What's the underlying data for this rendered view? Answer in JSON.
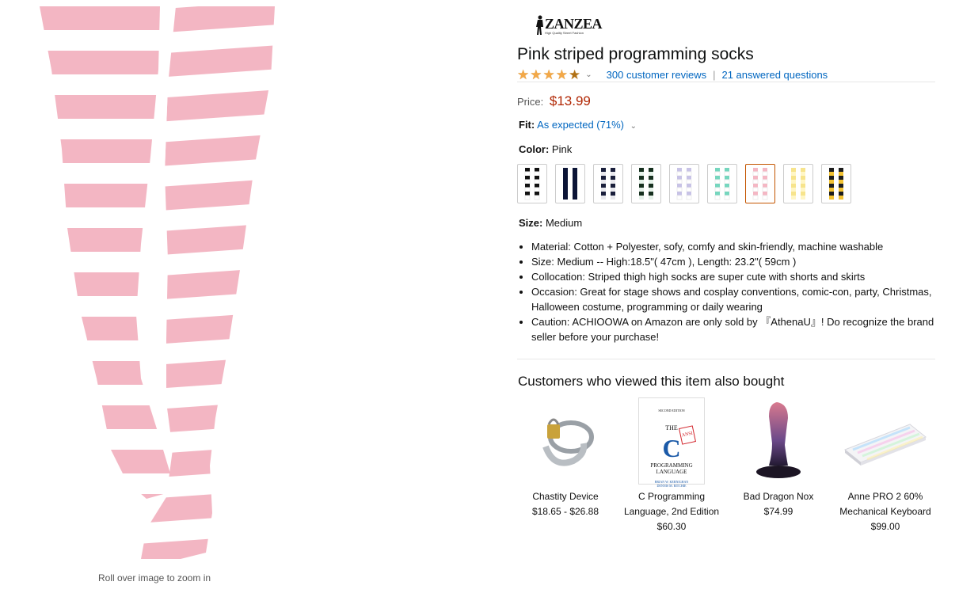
{
  "image": {
    "zoom_hint": "Roll over image to zoom in",
    "sock_colors": [
      "#f3b6c3",
      "#ffffff"
    ]
  },
  "brand": {
    "name": "ZANZEA",
    "tagline": "High Quality Street Fashion"
  },
  "product": {
    "title": "Pink striped programming socks",
    "rating": {
      "stars": 4,
      "reviews_text": "300 customer reviews",
      "separator": "|",
      "questions_text": "21 answered questions"
    },
    "price": {
      "label": "Price:",
      "value": "$13.99"
    },
    "fit": {
      "label": "Fit:",
      "value": "As expected (71%)"
    },
    "color": {
      "label": "Color:",
      "value": "Pink"
    },
    "size": {
      "label": "Size:",
      "value": "Medium"
    },
    "swatches": [
      {
        "a": "#111111",
        "b": "#ffffff"
      },
      {
        "a": "#0b1436",
        "b": "#0b1436"
      },
      {
        "a": "#1a1f3c",
        "b": "#e9e9ee"
      },
      {
        "a": "#16301f",
        "b": "#e6f2ea"
      },
      {
        "a": "#c8c3e6",
        "b": "#ffffff"
      },
      {
        "a": "#76d6be",
        "b": "#ffffff"
      },
      {
        "a": "#f4b7c4",
        "b": "#ffffff"
      },
      {
        "a": "#f7e48c",
        "b": "#fff6c6"
      },
      {
        "a": "#1d1d1d",
        "b": "#f2c232"
      }
    ],
    "bullets": [
      "Material: Cotton + Polyester, sofy, comfy and skin-friendly, machine washable",
      "Size: Medium -- High:18.5\"( 47cm ), Length: 23.2\"( 59cm )",
      "Collocation: Striped thigh high socks are super cute with shorts and skirts",
      "Occasion: Great for stage shows and cosplay conventions, comic-con, party, Christmas, Halloween costume, programming or daily wearing",
      "Caution: ACHIOOWA on Amazon are only sold by 『AthenaU』! Do recognize the brand seller before your purchase!"
    ]
  },
  "also_bought": {
    "title": "Customers who viewed this item also bought",
    "items": [
      {
        "name": "Chastity Device",
        "price": "$18.65 - $26.88"
      },
      {
        "name": "C Programming Language, 2nd Edition",
        "price": "$60.30"
      },
      {
        "name": "Bad Dragon Nox",
        "price": "$74.99"
      },
      {
        "name": "Anne PRO 2 60% Mechanical Keyboard",
        "price": "$99.00"
      }
    ],
    "book_cover": {
      "edition": "SECOND EDITION",
      "the": "THE",
      "letter": "C",
      "ansi": "ANSI",
      "title": "PROGRAMMING LANGUAGE",
      "authors": "BRIAN W. KERNIGHAN DENNIS M. RITCHIE"
    }
  }
}
